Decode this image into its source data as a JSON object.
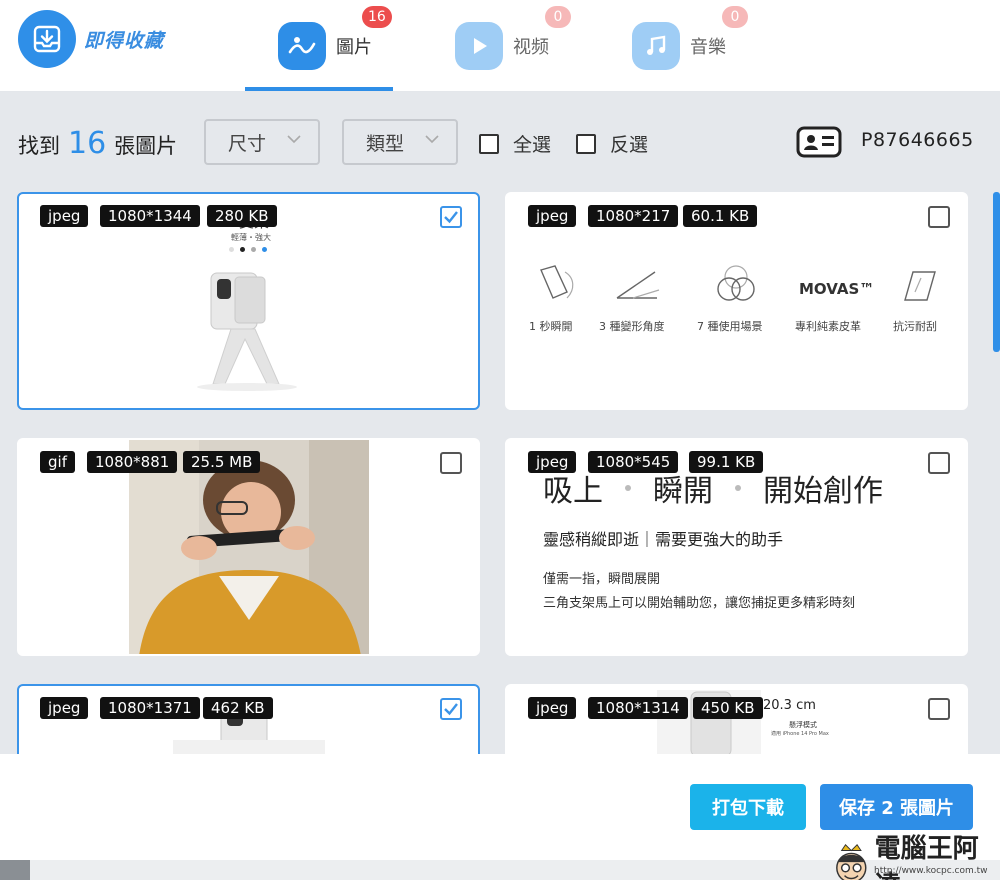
{
  "app": {
    "logo_text": "即得收藏"
  },
  "tabs": [
    {
      "label": "圖片",
      "badge": "16"
    },
    {
      "label": "视频",
      "badge": "0"
    },
    {
      "label": "音樂",
      "badge": "0"
    }
  ],
  "toolbar": {
    "found_prefix": "找到",
    "found_count": "16",
    "found_suffix": "張圖片",
    "size_dropdown": "尺寸",
    "type_dropdown": "類型",
    "select_all": "全選",
    "invert_select": "反選",
    "user_id": "P87646665"
  },
  "cards": [
    {
      "format": "jpeg",
      "dims": "1080*1344",
      "size": "280 KB",
      "selected": true,
      "content": {
        "title_fragment": "支架",
        "subtitle": "輕薄・強大"
      }
    },
    {
      "format": "jpeg",
      "dims": "1080*217",
      "size": "60.1 KB",
      "selected": false,
      "content": {
        "brand": "MOVAS™",
        "features": [
          "1 秒瞬開",
          "3 種變形角度",
          "7 種使用場景",
          "專利純素皮革",
          "抗污耐刮"
        ]
      }
    },
    {
      "format": "gif",
      "dims": "1080*881",
      "size": "25.5 MB",
      "selected": false
    },
    {
      "format": "jpeg",
      "dims": "1080*545",
      "size": "99.1 KB",
      "selected": false,
      "content": {
        "headline": [
          "吸上",
          "瞬開",
          "開始創作"
        ],
        "subheadline": "靈感稍縱即逝｜需要更強大的助手",
        "line1": "僅需一指，瞬間展開",
        "line2": "三角支架馬上可以開始輔助您，讓您捕捉更多精彩時刻"
      }
    },
    {
      "format": "jpeg",
      "dims": "1080*1371",
      "size": "462 KB",
      "selected": true
    },
    {
      "format": "jpeg",
      "dims": "1080*1314",
      "size": "450 KB",
      "selected": false,
      "content": {
        "measure": "20.3 cm",
        "mode": "懸浮模式",
        "note": "適用 iPhone 14 Pro Max"
      }
    }
  ],
  "footer": {
    "pack_download": "打包下載",
    "save_button": "保存 2 張圖片"
  },
  "watermark": {
    "text": "電腦王阿達",
    "url": "http://www.kocpc.com.tw"
  },
  "colors": {
    "accent": "#2e8ee7",
    "badge": "#ec4d4d",
    "pack_btn": "#1bb3ea",
    "save_btn": "#2e8ee7"
  }
}
